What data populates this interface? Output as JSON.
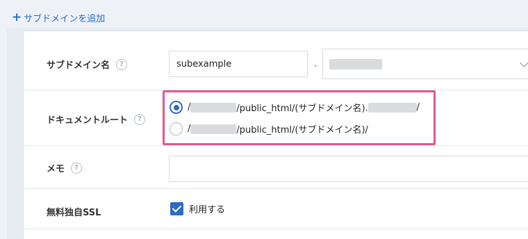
{
  "add_subdomain_label": "サブドメインを追加",
  "fields": {
    "subdomain_name": {
      "label": "サブドメイン名",
      "value": "subexample",
      "separator": "."
    },
    "document_root": {
      "label": "ドキュメントルート",
      "option1": {
        "prefix": "/",
        "middle": "/public_html/(サブドメイン名).",
        "suffix": "/",
        "selected": true
      },
      "option2": {
        "prefix": "/",
        "middle": "/public_html/(サブドメイン名)/",
        "selected": false
      }
    },
    "memo": {
      "label": "メモ",
      "value": ""
    },
    "ssl": {
      "label": "無料独自SSL",
      "checkbox_label": "利用する",
      "checked": true
    }
  },
  "help_symbol": "?",
  "colors": {
    "accent": "#2d6cc4",
    "highlight": "#e35591"
  }
}
